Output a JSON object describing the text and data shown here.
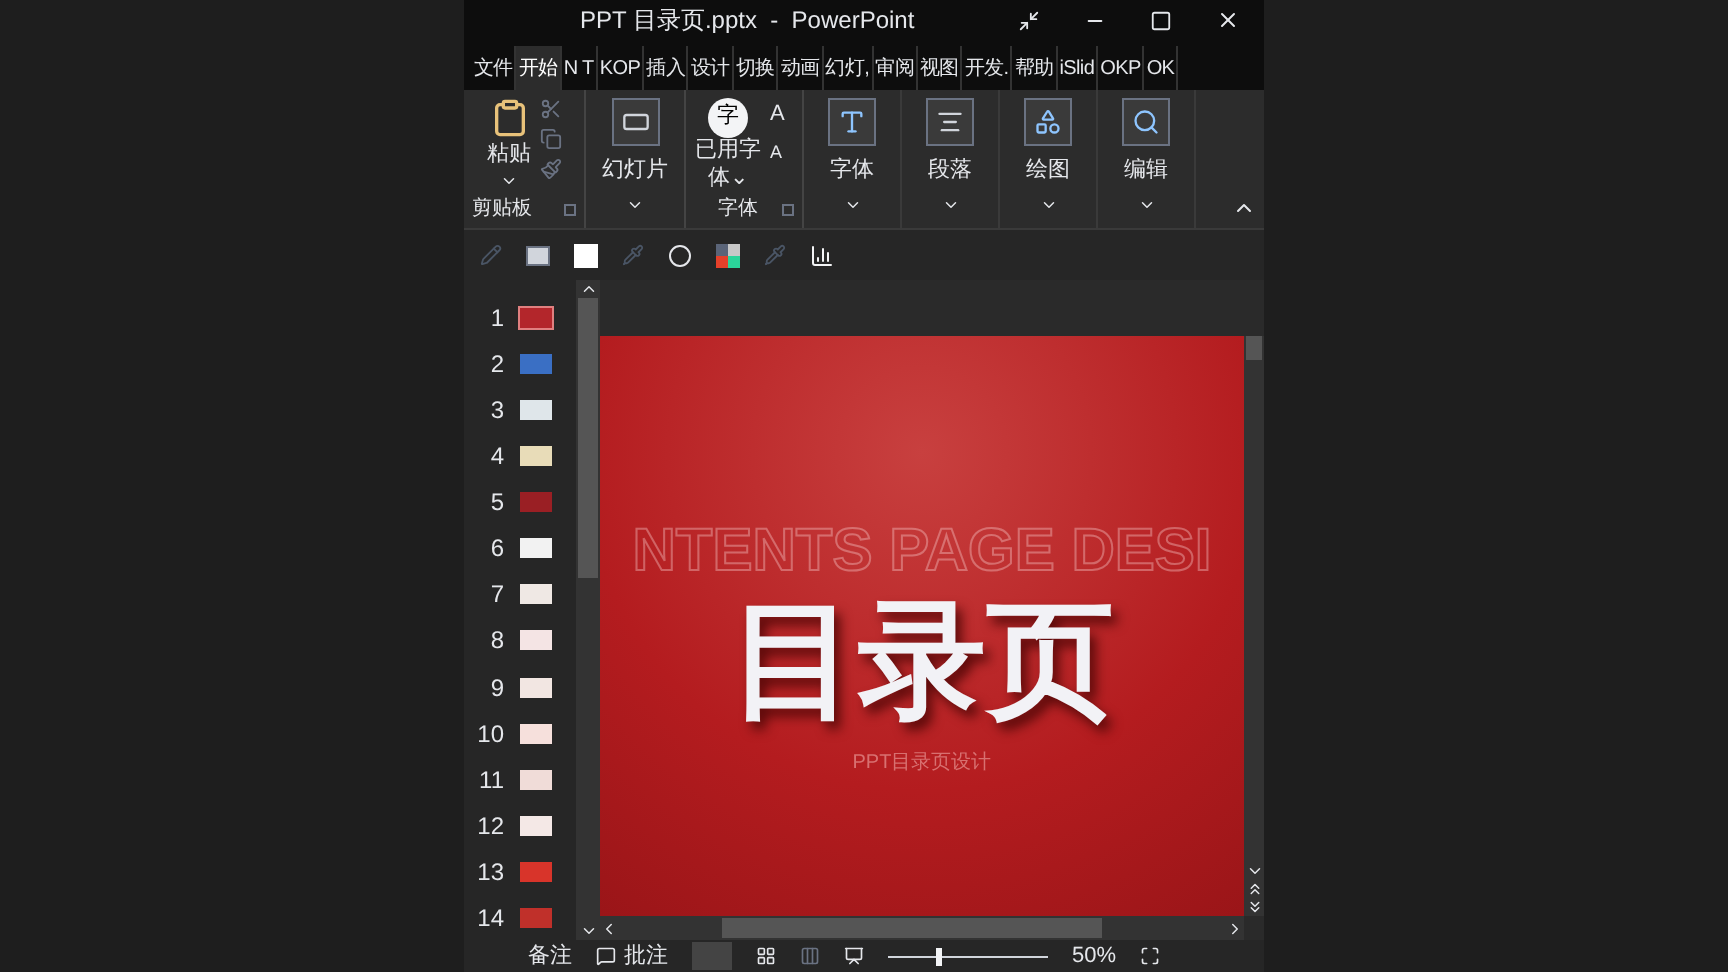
{
  "window": {
    "title": "PPT 目录页.pptx  -  PowerPoint"
  },
  "tabs": [
    {
      "label": "文件",
      "selected": false
    },
    {
      "label": "开始",
      "selected": true
    },
    {
      "label": "N T",
      "selected": false
    },
    {
      "label": "KOP",
      "selected": false
    },
    {
      "label": "插入",
      "selected": false
    },
    {
      "label": "设计",
      "selected": false
    },
    {
      "label": "切换",
      "selected": false
    },
    {
      "label": "动画",
      "selected": false
    },
    {
      "label": "幻灯,",
      "selected": false
    },
    {
      "label": "审阅",
      "selected": false
    },
    {
      "label": "视图",
      "selected": false
    },
    {
      "label": "开发.",
      "selected": false
    },
    {
      "label": "帮助",
      "selected": false
    },
    {
      "label": "iSlid",
      "selected": false
    },
    {
      "label": "OKP",
      "selected": false
    },
    {
      "label": "OK",
      "selected": false
    }
  ],
  "ribbon": {
    "clipboard": {
      "paste": "粘贴",
      "group_label": "剪贴板"
    },
    "slides": "幻灯片",
    "fonts": {
      "icon_char": "字",
      "grow": "A",
      "shrink": "A",
      "used_fonts": "已用字体",
      "caret": "⌄",
      "group_label": "字体"
    },
    "buttons": [
      {
        "kind": "font",
        "label": "字体"
      },
      {
        "kind": "paragraph",
        "label": "段落"
      },
      {
        "kind": "drawing",
        "label": "绘图"
      },
      {
        "kind": "editing",
        "label": "编辑"
      }
    ]
  },
  "slides": [
    {
      "number": "1",
      "selected": true
    },
    {
      "number": "2",
      "selected": false
    },
    {
      "number": "3",
      "selected": false
    },
    {
      "number": "4",
      "selected": false
    },
    {
      "number": "5",
      "selected": false
    },
    {
      "number": "6",
      "selected": false
    },
    {
      "number": "7",
      "selected": false
    },
    {
      "number": "8",
      "selected": false
    },
    {
      "number": "9",
      "selected": false
    },
    {
      "number": "10",
      "selected": false
    },
    {
      "number": "11",
      "selected": false
    },
    {
      "number": "12",
      "selected": false
    },
    {
      "number": "13",
      "selected": false
    },
    {
      "number": "14",
      "selected": false
    }
  ],
  "slide": {
    "background_text": "NTENTS PAGE DESI",
    "title": "目录页",
    "subtitle": "PPT目录页设计"
  },
  "status_bar": {
    "notes": "备注",
    "comments": "批注",
    "zoom": {
      "level": 0.3
    },
    "zoom_percent": "50%"
  }
}
